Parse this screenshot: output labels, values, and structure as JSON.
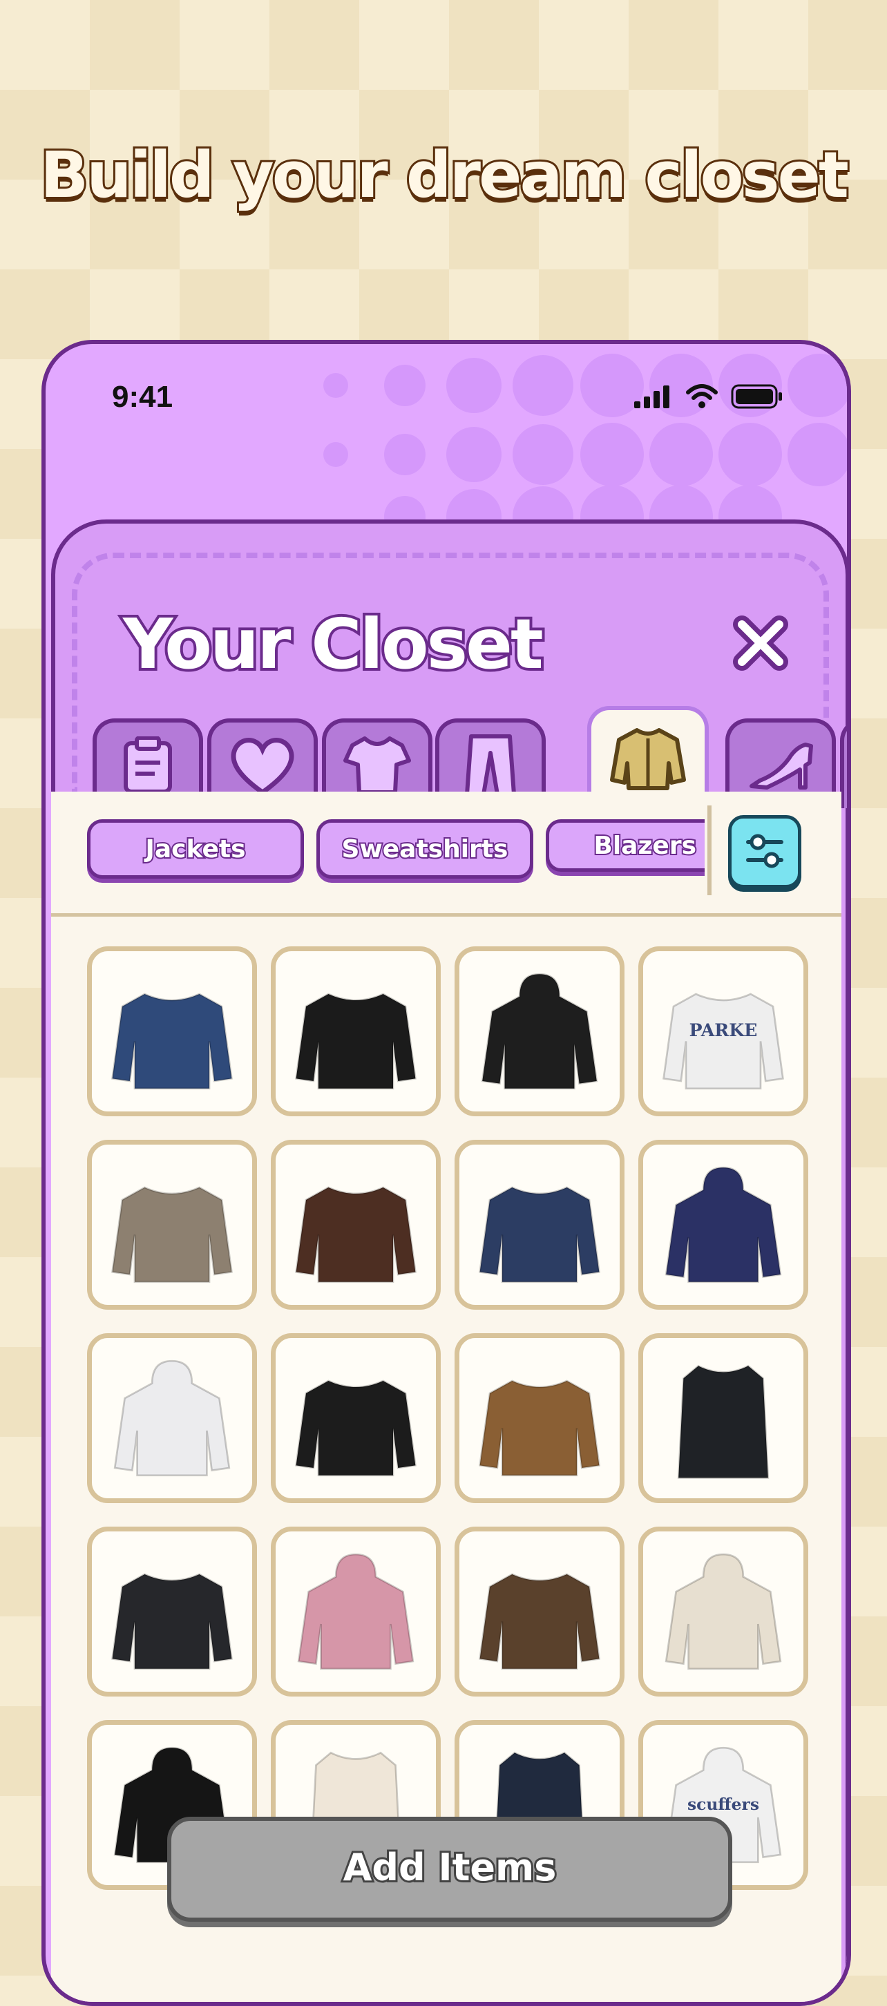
{
  "headline": "Build your dream closet",
  "status_bar": {
    "time": "9:41"
  },
  "closet": {
    "title": "Your Closet",
    "tabs": [
      {
        "name": "tab-notes",
        "icon": "clipboard-icon"
      },
      {
        "name": "tab-favorites",
        "icon": "heart-icon"
      },
      {
        "name": "tab-tops",
        "icon": "tshirt-icon"
      },
      {
        "name": "tab-bottoms",
        "icon": "pants-icon"
      },
      {
        "name": "tab-outerwear",
        "icon": "jacket-icon",
        "active": true
      },
      {
        "name": "tab-shoes",
        "icon": "heel-icon"
      },
      {
        "name": "tab-dresses",
        "icon": "dress-icon"
      }
    ],
    "chips": [
      "Jackets",
      "Sweatshirts",
      "Blazers"
    ],
    "items": [
      {
        "label": "denim jacket",
        "color": "#2f4a7a"
      },
      {
        "label": "black blazer",
        "color": "#1b1b1b"
      },
      {
        "label": "black hoodie",
        "color": "#1e1e1e"
      },
      {
        "label": "white PARKE sweatshirt",
        "color": "#eeeeee",
        "text": "PARKE"
      },
      {
        "label": "gray wool jacket",
        "color": "#8d8070"
      },
      {
        "label": "brown leather jacket",
        "color": "#4d2e22"
      },
      {
        "label": "denim biker jacket",
        "color": "#2c3d63"
      },
      {
        "label": "navy hoodie",
        "color": "#2b3165"
      },
      {
        "label": "white zip hoodie",
        "color": "#ececee"
      },
      {
        "label": "black fleece jacket",
        "color": "#1c1c1c"
      },
      {
        "label": "tan work jacket",
        "color": "#8a5f34"
      },
      {
        "label": "black long coat",
        "color": "#1f2226"
      },
      {
        "label": "black double-breasted coat",
        "color": "#26272b"
      },
      {
        "label": "striped knit hoodie",
        "color": "#d696a8"
      },
      {
        "label": "brown short coat",
        "color": "#5a412c"
      },
      {
        "label": "cream zip knit",
        "color": "#e7dfd0"
      },
      {
        "label": "black zip hoodie",
        "color": "#151515"
      },
      {
        "label": "cream coat",
        "color": "#efe6d8"
      },
      {
        "label": "navy coat",
        "color": "#202a3e"
      },
      {
        "label": "white scuffers hoodie",
        "color": "#f0f0f0",
        "text": "scuffers"
      }
    ],
    "add_button": "Add Items"
  },
  "colors": {
    "purple": "#e2a8ff",
    "outline": "#6b2b8c",
    "cream": "#fbf6ec",
    "tile_border": "#d8c39a"
  }
}
